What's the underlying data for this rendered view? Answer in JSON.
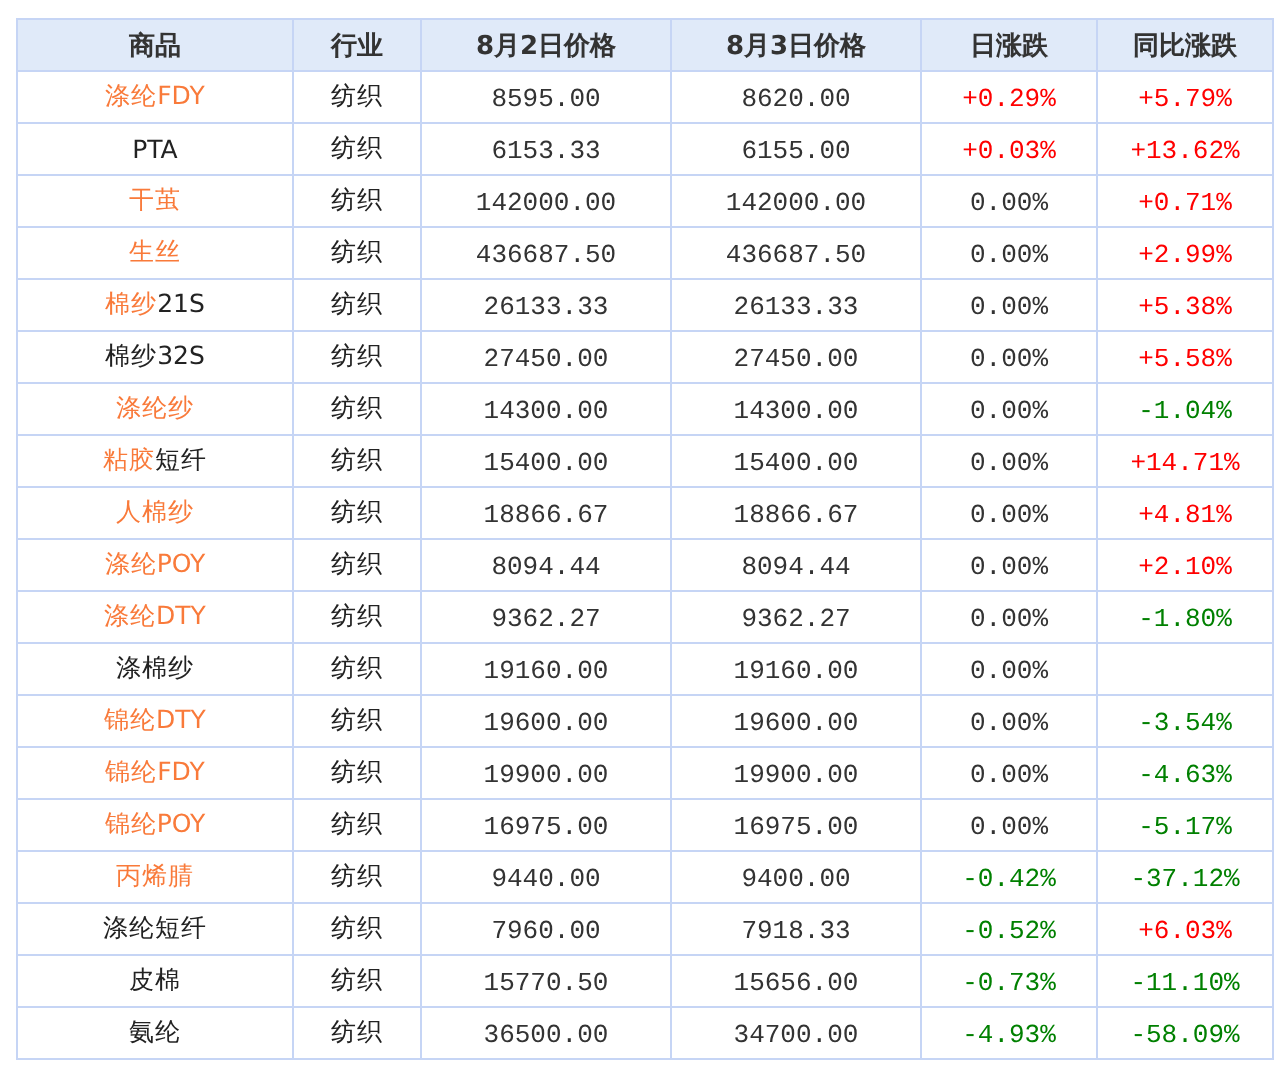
{
  "columns": [
    "商品",
    "行业",
    "8月2日价格",
    "8月3日价格",
    "日涨跌",
    "同比涨跌"
  ],
  "rows": [
    {
      "link": "涤纶FDY",
      "industry": "纺织",
      "price_aug2": "8595.00",
      "price_aug3": "8620.00",
      "daily": {
        "text": "+0.29%",
        "color": "#ff0000"
      },
      "yoy": {
        "text": "+5.79%",
        "color": "#ff0000"
      }
    },
    {
      "name": "PTA",
      "industry": "纺织",
      "price_aug2": "6153.33",
      "price_aug3": "6155.00",
      "daily": {
        "text": "+0.03%",
        "color": "#ff0000"
      },
      "yoy": {
        "text": "+13.62%",
        "color": "#ff0000"
      }
    },
    {
      "link": "干茧",
      "industry": "纺织",
      "price_aug2": "142000.00",
      "price_aug3": "142000.00",
      "daily": {
        "text": "0.00%",
        "color": "#333333"
      },
      "yoy": {
        "text": "+0.71%",
        "color": "#ff0000"
      }
    },
    {
      "link": "生丝",
      "industry": "纺织",
      "price_aug2": "436687.50",
      "price_aug3": "436687.50",
      "daily": {
        "text": "0.00%",
        "color": "#333333"
      },
      "yoy": {
        "text": "+2.99%",
        "color": "#ff0000"
      }
    },
    {
      "link": "棉纱",
      "name": "21S",
      "industry": "纺织",
      "price_aug2": "26133.33",
      "price_aug3": "26133.33",
      "daily": {
        "text": "0.00%",
        "color": "#333333"
      },
      "yoy": {
        "text": "+5.38%",
        "color": "#ff0000"
      }
    },
    {
      "name": "棉纱32S",
      "industry": "纺织",
      "price_aug2": "27450.00",
      "price_aug3": "27450.00",
      "daily": {
        "text": "0.00%",
        "color": "#333333"
      },
      "yoy": {
        "text": "+5.58%",
        "color": "#ff0000"
      }
    },
    {
      "link": "涤纶纱",
      "industry": "纺织",
      "price_aug2": "14300.00",
      "price_aug3": "14300.00",
      "daily": {
        "text": "0.00%",
        "color": "#333333"
      },
      "yoy": {
        "text": "-1.04%",
        "color": "#008000"
      }
    },
    {
      "link": "粘胶",
      "name": "短纤",
      "industry": "纺织",
      "price_aug2": "15400.00",
      "price_aug3": "15400.00",
      "daily": {
        "text": "0.00%",
        "color": "#333333"
      },
      "yoy": {
        "text": "+14.71%",
        "color": "#ff0000"
      }
    },
    {
      "link": "人棉纱",
      "industry": "纺织",
      "price_aug2": "18866.67",
      "price_aug3": "18866.67",
      "daily": {
        "text": "0.00%",
        "color": "#333333"
      },
      "yoy": {
        "text": "+4.81%",
        "color": "#ff0000"
      }
    },
    {
      "link": "涤纶POY",
      "industry": "纺织",
      "price_aug2": "8094.44",
      "price_aug3": "8094.44",
      "daily": {
        "text": "0.00%",
        "color": "#333333"
      },
      "yoy": {
        "text": "+2.10%",
        "color": "#ff0000"
      }
    },
    {
      "link": "涤纶DTY",
      "industry": "纺织",
      "price_aug2": "9362.27",
      "price_aug3": "9362.27",
      "daily": {
        "text": "0.00%",
        "color": "#333333"
      },
      "yoy": {
        "text": "-1.80%",
        "color": "#008000"
      }
    },
    {
      "name": "涤棉纱",
      "industry": "纺织",
      "price_aug2": "19160.00",
      "price_aug3": "19160.00",
      "daily": {
        "text": "0.00%",
        "color": "#333333"
      }
    },
    {
      "link": "锦纶DTY",
      "industry": "纺织",
      "price_aug2": "19600.00",
      "price_aug3": "19600.00",
      "daily": {
        "text": "0.00%",
        "color": "#333333"
      },
      "yoy": {
        "text": "-3.54%",
        "color": "#008000"
      }
    },
    {
      "link": "锦纶FDY",
      "industry": "纺织",
      "price_aug2": "19900.00",
      "price_aug3": "19900.00",
      "daily": {
        "text": "0.00%",
        "color": "#333333"
      },
      "yoy": {
        "text": "-4.63%",
        "color": "#008000"
      }
    },
    {
      "link": "锦纶POY",
      "industry": "纺织",
      "price_aug2": "16975.00",
      "price_aug3": "16975.00",
      "daily": {
        "text": "0.00%",
        "color": "#333333"
      },
      "yoy": {
        "text": "-5.17%",
        "color": "#008000"
      }
    },
    {
      "link": "丙烯腈",
      "industry": "纺织",
      "price_aug2": "9440.00",
      "price_aug3": "9400.00",
      "daily": {
        "text": "-0.42%",
        "color": "#008000"
      },
      "yoy": {
        "text": "-37.12%",
        "color": "#008000"
      }
    },
    {
      "name": "涤纶短纤",
      "industry": "纺织",
      "price_aug2": "7960.00",
      "price_aug3": "7918.33",
      "daily": {
        "text": "-0.52%",
        "color": "#008000"
      },
      "yoy": {
        "text": "+6.03%",
        "color": "#ff0000"
      }
    },
    {
      "name": "皮棉",
      "industry": "纺织",
      "price_aug2": "15770.50",
      "price_aug3": "15656.00",
      "daily": {
        "text": "-0.73%",
        "color": "#008000"
      },
      "yoy": {
        "text": "-11.10%",
        "color": "#008000"
      }
    },
    {
      "name": "氨纶",
      "industry": "纺织",
      "price_aug2": "36500.00",
      "price_aug3": "34700.00",
      "daily": {
        "text": "-4.93%",
        "color": "#008000"
      },
      "yoy": {
        "text": "-58.09%",
        "color": "#008000"
      }
    }
  ]
}
